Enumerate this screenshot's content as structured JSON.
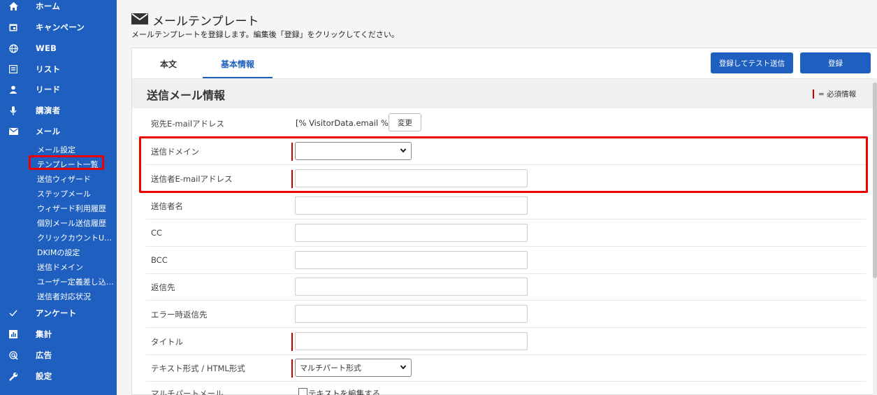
{
  "sidebar": {
    "nav": [
      {
        "label": "ホーム",
        "icon": "home-icon"
      },
      {
        "label": "キャンペーン",
        "icon": "calendar-icon"
      },
      {
        "label": "WEB",
        "icon": "globe-icon"
      },
      {
        "label": "リスト",
        "icon": "list-icon"
      },
      {
        "label": "リード",
        "icon": "person-icon"
      },
      {
        "label": "講演者",
        "icon": "microphone-icon"
      },
      {
        "label": "メール",
        "icon": "mail-icon"
      },
      {
        "label": "アンケート",
        "icon": "check-icon"
      },
      {
        "label": "集計",
        "icon": "chart-icon"
      },
      {
        "label": "広告",
        "icon": "ad-icon"
      },
      {
        "label": "設定",
        "icon": "wrench-icon"
      }
    ],
    "mail_sub": [
      "メール設定",
      "テンプレート一覧",
      "送信ウィザード",
      "ステップメール",
      "ウィザード利用履歴",
      "個別メール送信履歴",
      "クリックカウントU…",
      "DKIMの設定",
      "送信ドメイン",
      "ユーザー定義差し込…",
      "送信者対応状況"
    ]
  },
  "header": {
    "title": "メールテンプレート",
    "description": "メールテンプレートを登録します。編集後「登録」をクリックしてください。"
  },
  "tabs": [
    "本文",
    "基本情報"
  ],
  "buttons": {
    "register_test": "登録してテスト送信",
    "register": "登録"
  },
  "section": {
    "title": "送信メール情報",
    "legend": "= 必須情報"
  },
  "form": {
    "to_label": "宛先E-mailアドレス",
    "to_value": "[% VisitorData.email %]",
    "change_button": "変更",
    "domain_label": "送信ドメイン",
    "domain_value": "",
    "from_email_label": "送信者E-mailアドレス",
    "from_name_label": "送信者名",
    "cc_label": "CC",
    "bcc_label": "BCC",
    "reply_label": "返信先",
    "error_reply_label": "エラー時返信先",
    "title_label": "タイトル",
    "format_label": "テキスト形式 / HTML形式",
    "format_value": "マルチパート形式",
    "multipart_label": "マルチパートメール",
    "edit_text_label": "テキストを編集する"
  },
  "colors": {
    "sidebar": "#1e5fc0",
    "required": "#cc0000",
    "highlight": "#ee0000"
  }
}
